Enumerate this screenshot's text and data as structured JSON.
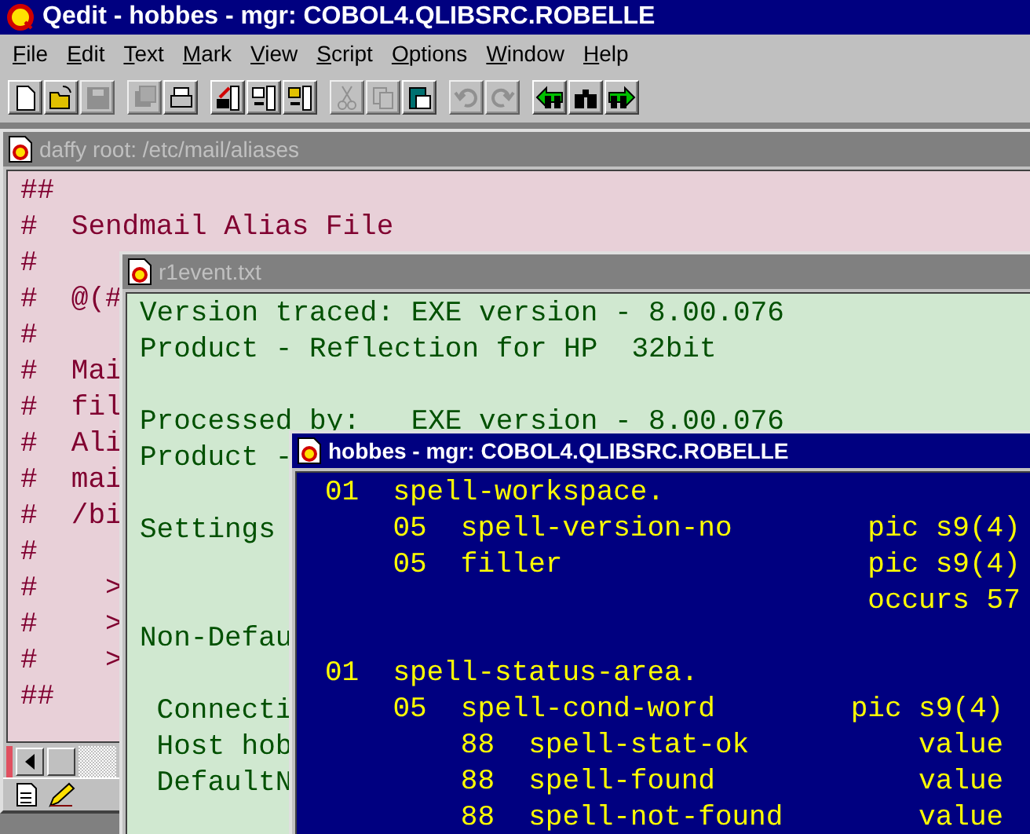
{
  "app": {
    "title": "Qedit - hobbes - mgr: COBOL4.QLIBSRC.ROBELLE"
  },
  "menu": [
    "File",
    "Edit",
    "Text",
    "Mark",
    "View",
    "Script",
    "Options",
    "Window",
    "Help"
  ],
  "toolbar": [
    [
      {
        "disabled": false
      },
      {
        "disabled": false
      },
      {
        "disabled": true
      }
    ],
    [
      {
        "disabled": true
      },
      {
        "disabled": false
      }
    ],
    [
      {
        "disabled": false
      },
      {
        "disabled": false
      },
      {
        "disabled": false
      }
    ],
    [
      {
        "disabled": true
      },
      {
        "disabled": true
      },
      {
        "disabled": false
      }
    ],
    [
      {
        "disabled": true
      },
      {
        "disabled": true
      }
    ],
    [
      {
        "disabled": false
      },
      {
        "disabled": false
      },
      {
        "disabled": false
      }
    ]
  ],
  "windows": [
    {
      "title": "daffy root: /etc/mail/aliases",
      "active": false,
      "kind": "pink",
      "lines": [
        {
          "kind": "text",
          "text": "##"
        },
        {
          "kind": "text",
          "text": "#  Sendmail Alias File"
        },
        {
          "kind": "text",
          "text": "#"
        },
        {
          "kind": "text",
          "text": "#  @(#"
        },
        {
          "kind": "text",
          "text": "#"
        },
        {
          "kind": "text",
          "text": "#  Mai"
        },
        {
          "kind": "text",
          "text": "#  fil"
        },
        {
          "kind": "text",
          "text": "#  Ali"
        },
        {
          "kind": "text",
          "text": "#  mai"
        },
        {
          "kind": "text",
          "text": "#  /bi"
        },
        {
          "kind": "text",
          "text": "#"
        },
        {
          "kind": "text",
          "text": "#    >"
        },
        {
          "kind": "text",
          "text": "#    >"
        },
        {
          "kind": "text",
          "text": "#    >"
        },
        {
          "kind": "text",
          "text": "##"
        }
      ],
      "footer": true
    },
    {
      "title": "r1event.txt",
      "active": false,
      "kind": "green",
      "lines": [
        {
          "kind": "text",
          "text": "Version traced: EXE version - 8.00.076"
        },
        {
          "kind": "text",
          "text": "Product - Reflection for HP  32bit"
        },
        {
          "kind": "blank"
        },
        {
          "kind": "text",
          "text": "Processed by:   EXE version - 8.00.076"
        },
        {
          "kind": "text",
          "text": "Product -"
        },
        {
          "kind": "blank"
        },
        {
          "kind": "text",
          "text": "Settings"
        },
        {
          "kind": "blank"
        },
        {
          "kind": "blank"
        },
        {
          "kind": "text",
          "text": "Non-Defau"
        },
        {
          "kind": "blank"
        },
        {
          "kind": "text",
          "text": " Connecti"
        },
        {
          "kind": "text",
          "text": " Host hob"
        },
        {
          "kind": "text",
          "text": " DefaultN"
        }
      ]
    },
    {
      "title": "hobbes - mgr: COBOL4.QLIBSRC.ROBELLE",
      "active": true,
      "kind": "blue",
      "lines": [
        {
          "kind": "text",
          "text": "01  spell-workspace."
        },
        {
          "kind": "text",
          "text": "    05  spell-version-no        pic s9(4)"
        },
        {
          "kind": "text",
          "text": "    05  filler                  pic s9(4)"
        },
        {
          "kind": "text",
          "text": "                                occurs 57"
        },
        {
          "kind": "blank"
        },
        {
          "kind": "text",
          "text": "01  spell-status-area."
        },
        {
          "kind": "text",
          "text": "    05  spell-cond-word        pic s9(4)"
        },
        {
          "kind": "text",
          "text": "        88  spell-stat-ok          value"
        },
        {
          "kind": "text",
          "text": "        88  spell-found            value"
        },
        {
          "kind": "text",
          "text": "        88  spell-not-found        value"
        }
      ]
    }
  ]
}
